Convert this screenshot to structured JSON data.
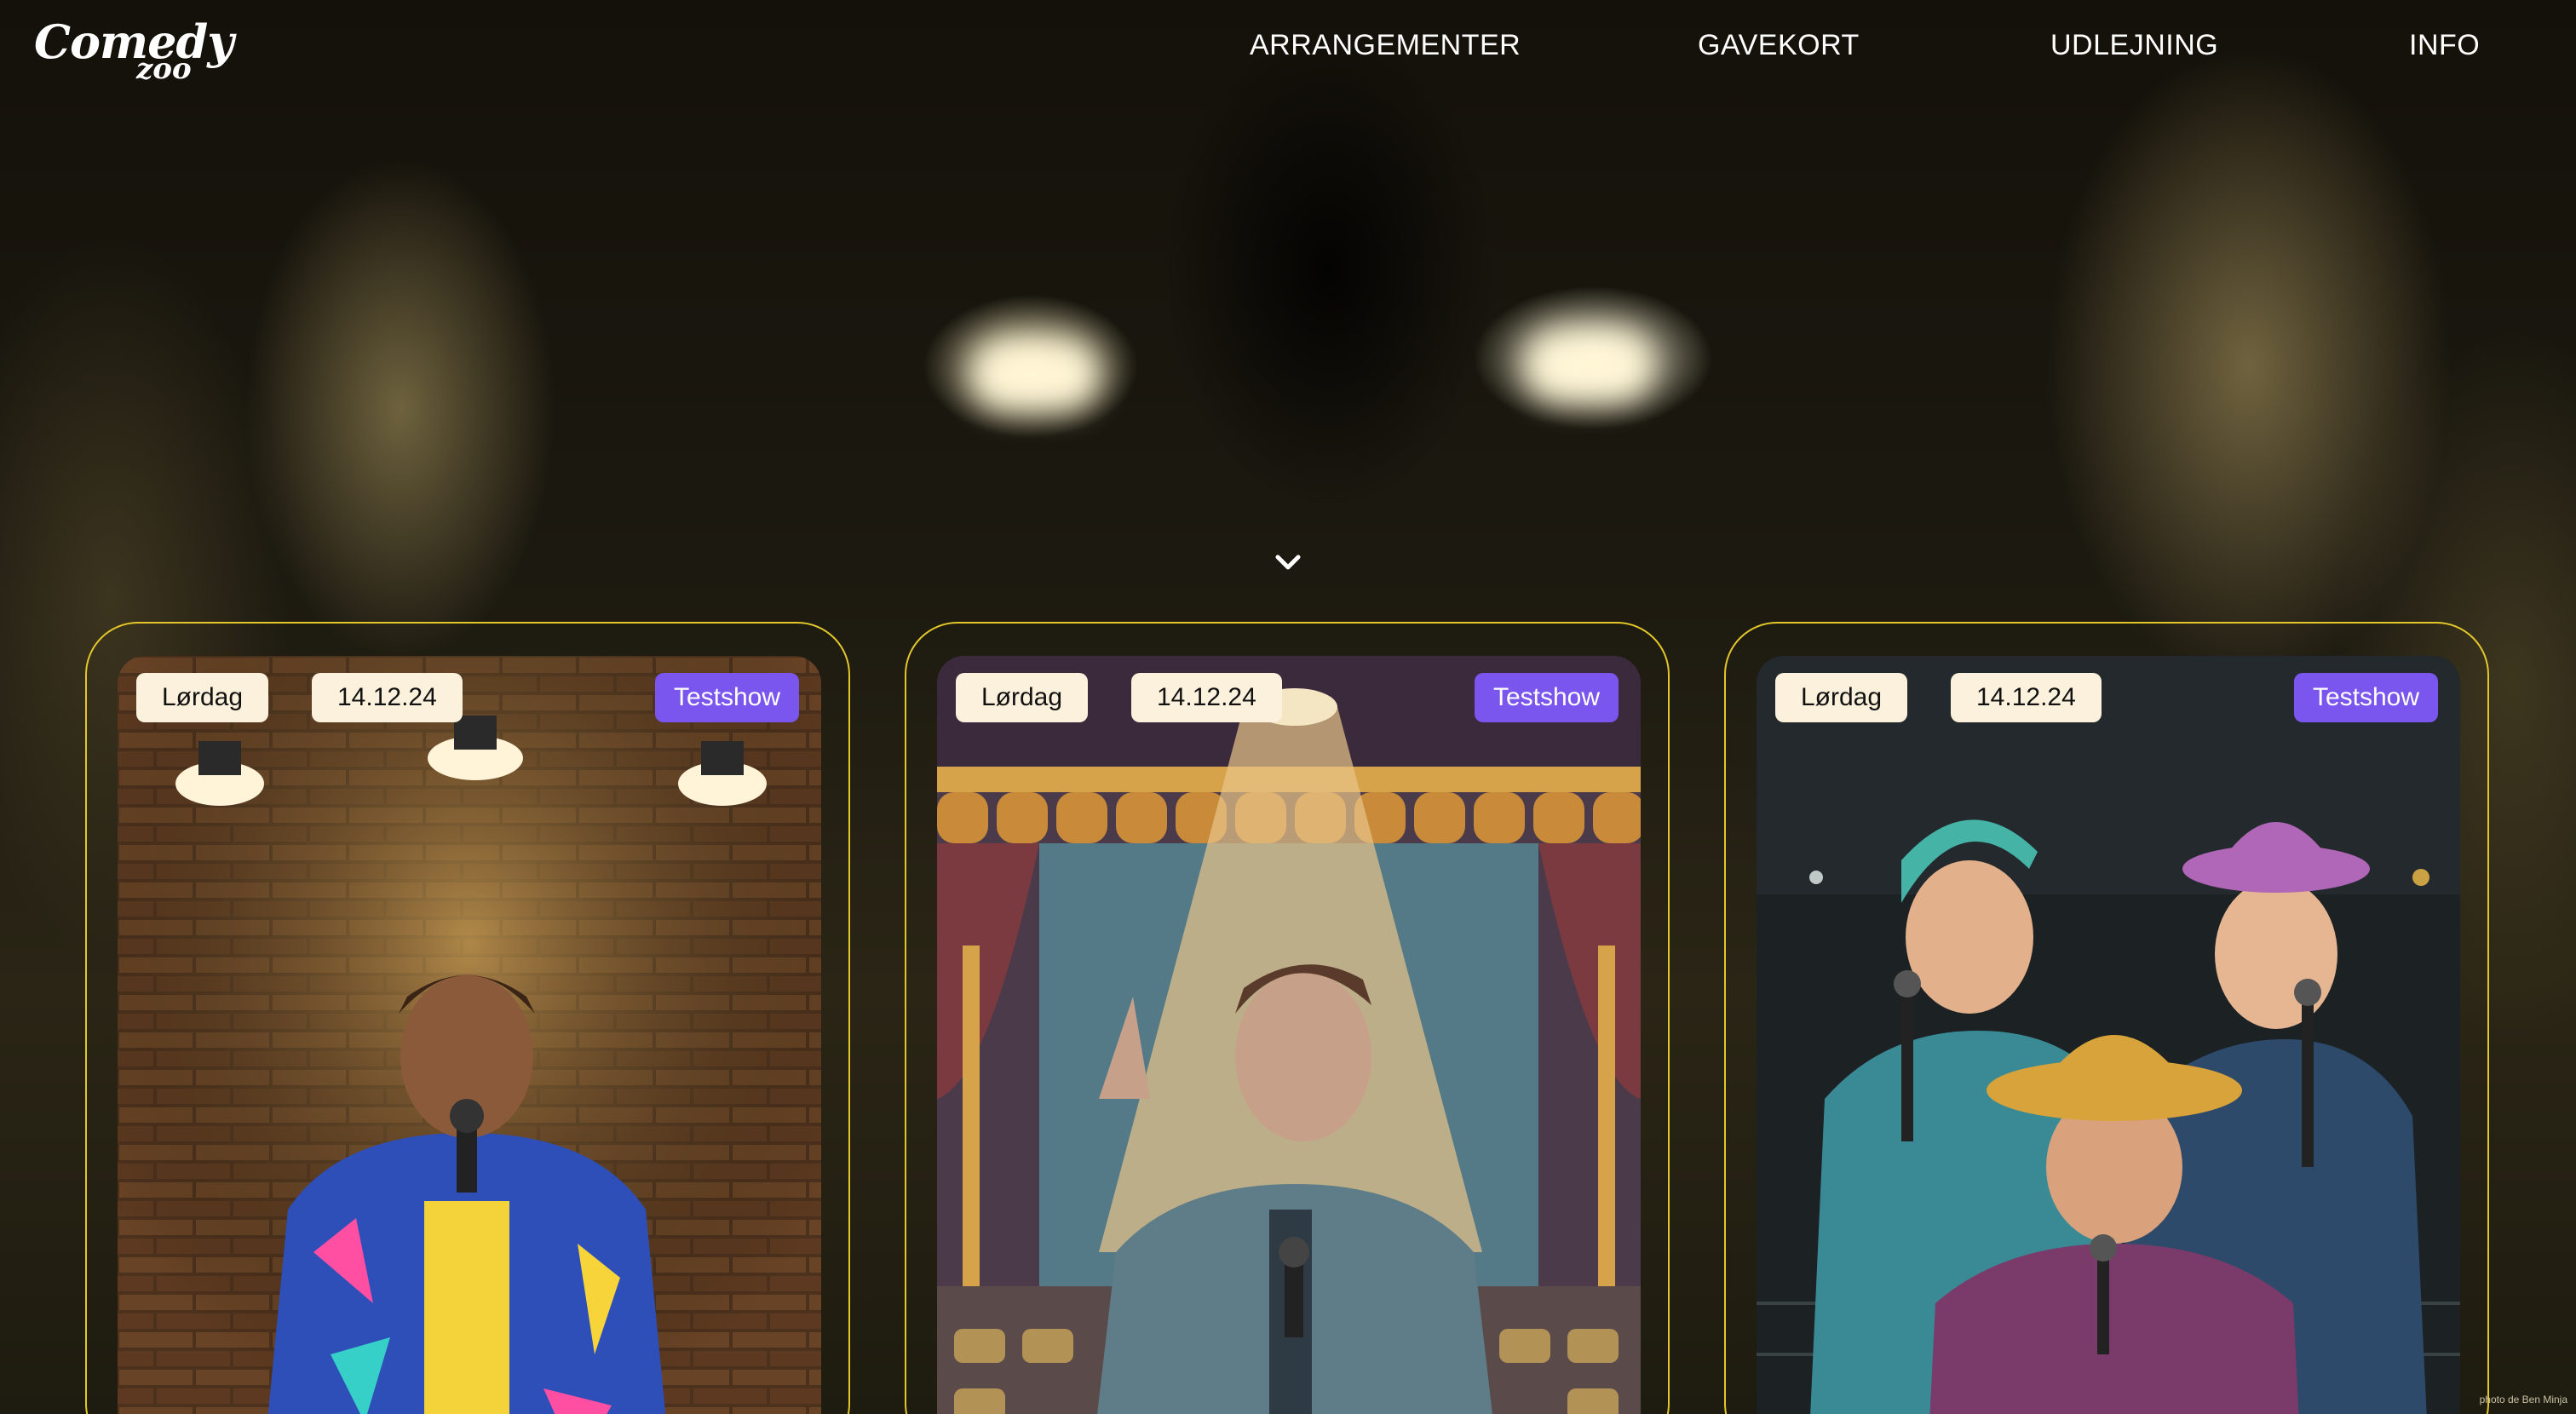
{
  "logo": {
    "line1": "Comedy",
    "line2": "zoo"
  },
  "nav": {
    "items": [
      "ARRANGEMENTER",
      "GAVEKORT",
      "UDLEJNING",
      "INFO"
    ]
  },
  "scroll_icon": "chevron-down-icon",
  "cards": [
    {
      "day": "Lørdag",
      "date": "14.12.24",
      "tag": "Testshow"
    },
    {
      "day": "Lørdag",
      "date": "14.12.24",
      "tag": "Testshow"
    },
    {
      "day": "Lørdag",
      "date": "14.12.24",
      "tag": "Testshow"
    }
  ],
  "credit": "photo de Ben Minja",
  "colors": {
    "card_border": "#e2c62a",
    "tag_bg": "#7a55ee",
    "pill_bg": "#fcf1dc"
  }
}
